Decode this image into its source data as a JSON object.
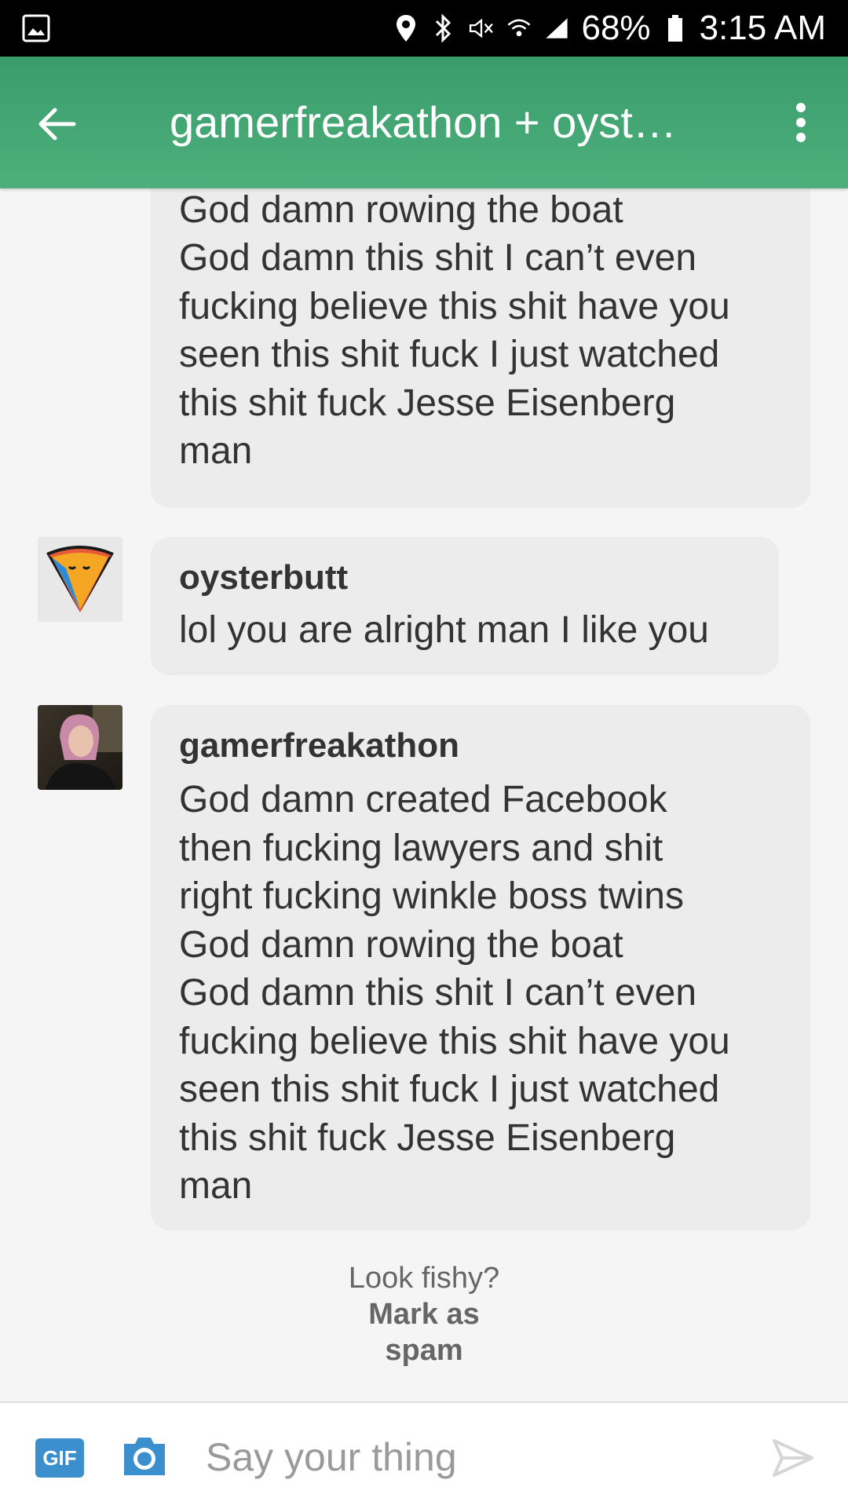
{
  "status_bar": {
    "battery": "68%",
    "time": "3:15 AM"
  },
  "app_bar": {
    "title": "gamerfreakathon + oyst…"
  },
  "messages": [
    {
      "username": "",
      "text": "right fucking winkle boss twins\nGod damn rowing the boat\nGod damn this shit I can’t even\nfucking believe this shit have you\nseen this shit fuck I just watched\nthis shit fuck Jesse Eisenberg\nman"
    },
    {
      "username": "oysterbutt",
      "text": "lol you are alright man I like you"
    },
    {
      "username": "gamerfreakathon",
      "text": "God damn created Facebook\nthen fucking lawyers and shit\nright fucking winkle boss twins\nGod damn rowing the boat\nGod damn this shit I can’t even\nfucking believe this shit have you\nseen this shit fuck I just watched\nthis shit fuck Jesse Eisenberg\nman"
    }
  ],
  "spam": {
    "question": "Look fishy?",
    "link": "Mark as\nspam"
  },
  "composer": {
    "gif_label": "GIF",
    "placeholder": "Say your thing"
  },
  "colors": {
    "app_bar": "#4caf7c",
    "bubble": "#ececec",
    "gif": "#3a8fcc"
  }
}
